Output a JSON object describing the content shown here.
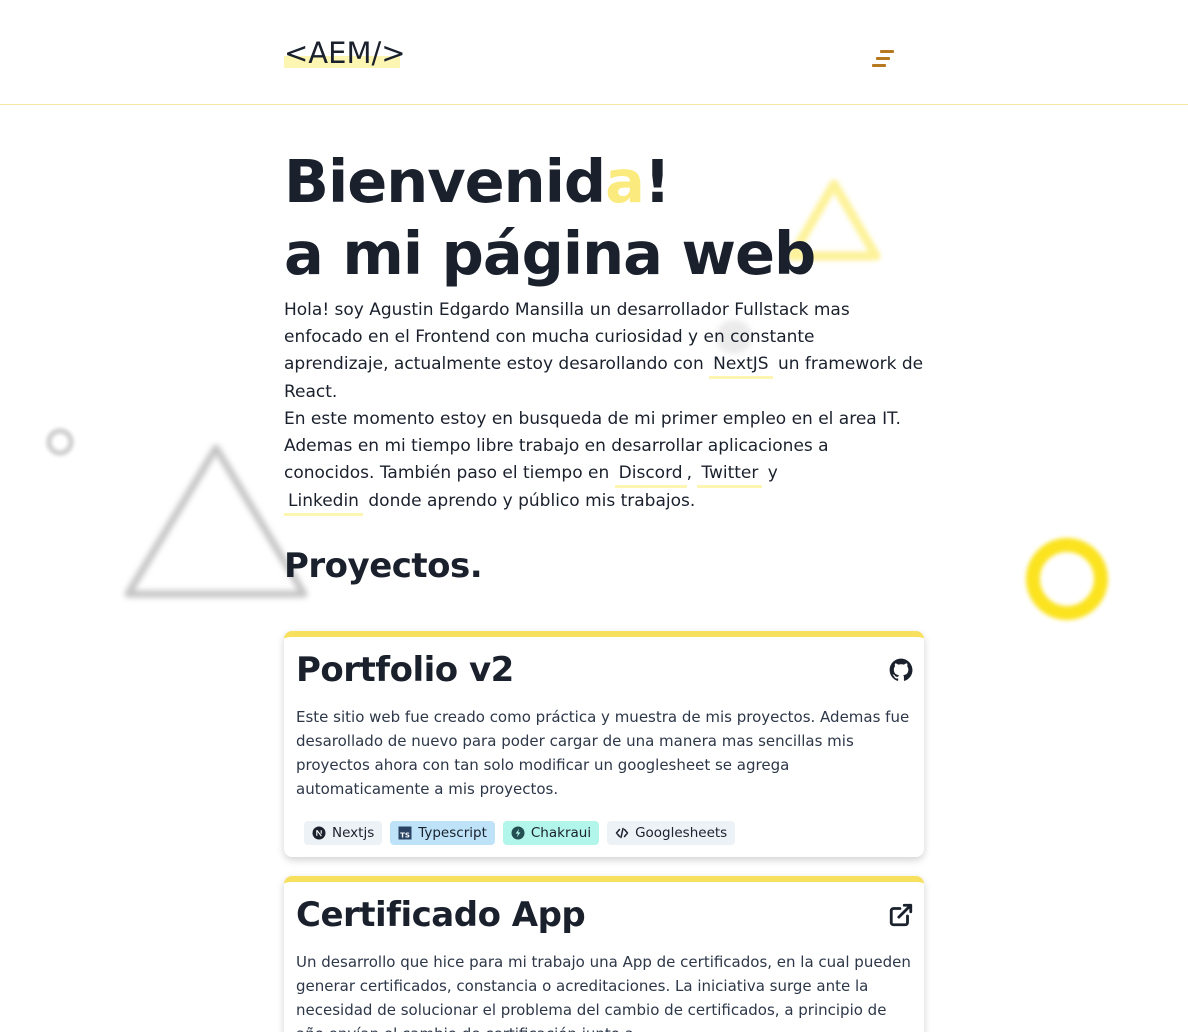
{
  "header": {
    "logo": "<AEM/>",
    "menu_icon": "menu-icon"
  },
  "hero": {
    "title_part1": "Bienvenid",
    "title_accent": "a",
    "title_part2": "!",
    "title_line2": "a mi página web",
    "intro_1": "Hola! soy Agustin Edgardo Mansilla un desarrollador Fullstack mas enfocado en el Frontend con mucha curiosidad y en constante aprendizaje, actualmente estoy desarollando con ",
    "link_nextjs": "NextJS",
    "intro_2": " un framework de React.",
    "intro_3": "En este momento estoy en busqueda de mi primer empleo en el area IT. Ademas en mi tiempo libre trabajo en desarrollar aplicaciones a conocidos. También paso el tiempo en ",
    "link_discord": "Discord",
    "sep_comma": ",",
    "link_twitter": "Twitter",
    "sep_y": " y",
    "link_linkedin": "Linkedin",
    "intro_4": " donde aprendo y público mis trabajos."
  },
  "projects": {
    "title": "Proyectos.",
    "items": [
      {
        "title": "Portfolio v2",
        "icon": "github-icon",
        "description": "Este sitio web fue creado como práctica y muestra de mis proyectos. Ademas fue desarollado de nuevo para poder cargar de una manera mas sencillas mis proyectos ahora con tan solo modificar un googlesheet se agrega automaticamente a mis proyectos.",
        "tags": [
          {
            "label": "Nextjs",
            "icon": "nextjs-icon",
            "bg": "#edf2f7"
          },
          {
            "label": "Typescript",
            "icon": "typescript-icon",
            "bg": "#bee3f8"
          },
          {
            "label": "Chakraui",
            "icon": "chakra-icon",
            "bg": "#b2f5ea"
          },
          {
            "label": "Googlesheets",
            "icon": "code-icon",
            "bg": "#edf2f7"
          }
        ]
      },
      {
        "title": "Certificado App",
        "icon": "external-link-icon",
        "description": "Un desarrollo que hice para mi trabajo una App de certificados, en la cual pueden generar certificados, constancia o acreditaciones. La iniciativa surge ante la necesidad de solucionar el problema del cambio de certificados, a principio de año envían el cambio de certificación junto a"
      }
    ]
  },
  "colors": {
    "accent_yellow": "#f6e05e",
    "highlight": "#fdf6b2",
    "menu_brown": "#b7791f",
    "text_dark": "#1a202c"
  }
}
